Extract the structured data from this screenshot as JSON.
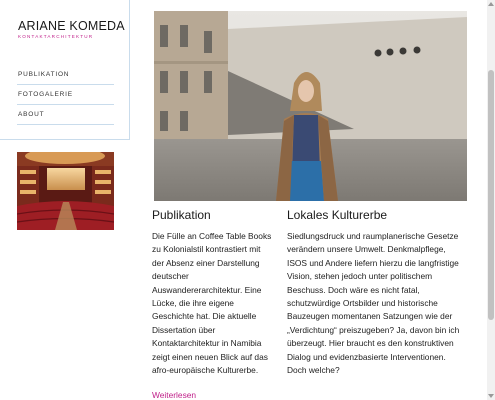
{
  "logo": {
    "title": "ARIANE KOMEDA",
    "subtitle": "KONTAKTARCHITEKTUR"
  },
  "nav": {
    "items": [
      {
        "label": "PUBLIKATION"
      },
      {
        "label": "FOTOGALERIE"
      },
      {
        "label": "ABOUT"
      }
    ]
  },
  "publikation": {
    "heading": "Publikation",
    "body": "Die Fülle an Coffee Table Books zu Kolonialstil kontrastiert mit der Absenz einer Darstellung deutscher Auswandererarchitektur. Eine Lücke, die ihre eigene Geschichte hat. Die aktuelle Dissertation über Kontaktarchitektur in Namibia zeigt einen neuen Blick auf das afro-europäische Kulturerbe.",
    "read_more": "Weiterlesen"
  },
  "kulturerbe": {
    "heading": "Lokales Kulturerbe",
    "body": "Siedlungsdruck und raumplanerische Gesetze verändern unsere Umwelt. Denkmalpflege, ISOS und Andere liefern hierzu die langfristige Vision, stehen jedoch unter politischem Beschuss. Doch wäre es nicht fatal, schutzwürdige Ortsbilder und historische Bauzeugen momentanen Satzungen wie der „Verdichtung“ preiszugeben? Ja, davon bin ich überzeugt. Hier braucht es den konstruktiven Dialog und evidenzbasierte Interventionen. Doch welche?"
  },
  "colors": {
    "accent": "#c0218a",
    "rule": "#c9dcec"
  }
}
